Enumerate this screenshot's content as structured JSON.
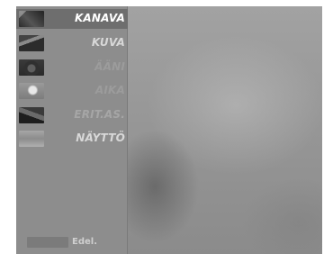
{
  "menu": {
    "items": [
      {
        "label": "KANAVA",
        "icon": "channel-thumbnail-icon",
        "state": "active"
      },
      {
        "label": "KUVA",
        "icon": "picture-thumbnail-icon",
        "state": "normal"
      },
      {
        "label": "ÄÄNI",
        "icon": "sound-thumbnail-icon",
        "state": "normal"
      },
      {
        "label": "AIKA",
        "icon": "time-thumbnail-icon",
        "state": "normal"
      },
      {
        "label": "ERIT.AS.",
        "icon": "special-settings-thumbnail-icon",
        "state": "normal"
      },
      {
        "label": "NÄYTTÖ",
        "icon": "screen-thumbnail-icon",
        "state": "normal"
      }
    ]
  },
  "footer": {
    "key_color": "grey",
    "label": "Edel."
  },
  "colors": {
    "panel": "#8d8d8d",
    "active_row": "#6e6e6e",
    "backdrop": "#979797",
    "label_active": "#ffffff"
  }
}
